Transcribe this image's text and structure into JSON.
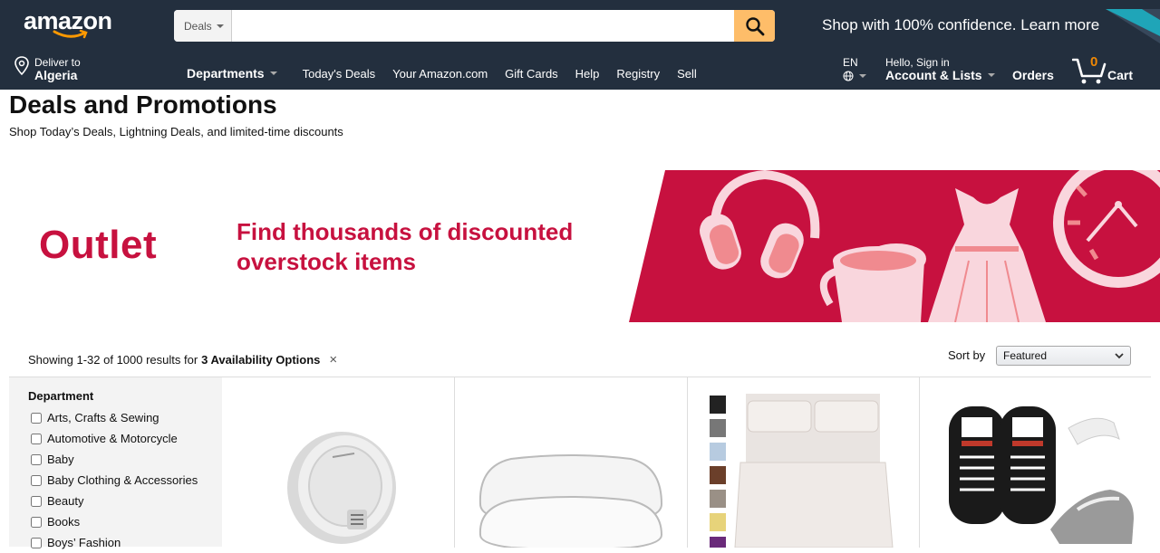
{
  "header": {
    "logo_text": "amazon",
    "search_category": "Deals",
    "search_placeholder": "",
    "promo_text": "Shop with 100% confidence. Learn more"
  },
  "subnav": {
    "deliver_line1": "Deliver to",
    "deliver_line2": "Algeria",
    "departments_label": "Departments",
    "links": [
      "Today's Deals",
      "Your Amazon.com",
      "Gift Cards",
      "Help",
      "Registry",
      "Sell"
    ],
    "language": "EN",
    "account_line1": "Hello, Sign in",
    "account_line2": "Account & Lists",
    "orders_label": "Orders",
    "cart_count": "0",
    "cart_label": "Cart"
  },
  "page": {
    "title": "Deals and Promotions",
    "subtitle": "Shop Today’s Deals, Lightning Deals, and limited-time discounts"
  },
  "banner": {
    "outlet": "Outlet",
    "line1": "Find thousands of discounted",
    "line2": "overstock items",
    "accent_color": "#c7113f"
  },
  "results": {
    "prefix": "Showing 1-32 of 1000 results for",
    "filter": "3 Availability Options",
    "clear_icon": "×"
  },
  "sort": {
    "label": "Sort by",
    "selected": "Featured"
  },
  "sidebar": {
    "title": "Department",
    "items": [
      "Arts, Crafts & Sewing",
      "Automotive & Motorcycle",
      "Baby",
      "Baby Clothing & Accessories",
      "Beauty",
      "Books",
      "Boys’ Fashion"
    ]
  },
  "products": [
    {
      "name": "smoke-detector"
    },
    {
      "name": "pillows"
    },
    {
      "name": "bed-sheets"
    },
    {
      "name": "no-tie-shoelaces"
    }
  ],
  "colors": {
    "nav_bg": "#232f3e",
    "search_button": "#febd69",
    "cart_count": "#f08804"
  }
}
